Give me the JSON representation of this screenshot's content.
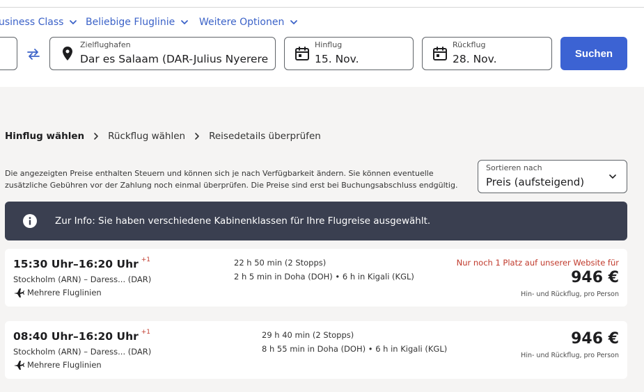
{
  "filters": {
    "cabin_label": "usiness Class",
    "airline_label": "Beliebige Fluglinie",
    "more_label": "Weitere Optionen"
  },
  "search": {
    "destination_label": "Zielflughafen",
    "destination_value": "Dar es Salaam (DAR-Julius Nyerere ...",
    "outbound_label": "Hinflug",
    "outbound_value": "15. Nov.",
    "return_label": "Rückflug",
    "return_value": "28. Nov.",
    "submit_label": "Suchen"
  },
  "breadcrumb": {
    "step1": "Hinflug wählen",
    "step2": "Rückflug wählen",
    "step3": "Reisedetails überprüfen"
  },
  "disclaimer": "Die angezeigten Preise enthalten Steuern und können sich je nach Verfügbarkeit ändern. Sie können eventuelle zusätzliche Gebühren vor der Zahlung noch einmal überprüfen. Die Preise sind erst bei Buchungsabschluss endgültig.",
  "sort": {
    "label": "Sortieren nach",
    "value": "Preis (aufsteigend)"
  },
  "info_banner": {
    "text": "Zur Info: Sie haben verschiedene Kabinenklassen für Ihre Flugreise ausgewählt."
  },
  "flights": [
    {
      "times": "15:30 Uhr–16:20 Uhr",
      "day_offset": "+1",
      "route": "Stockholm (ARN) – Daress... (DAR)",
      "airline": "Mehrere Fluglinien",
      "duration": "22 h 50 min (2 Stopps)",
      "layovers": "2 h 5 min in Doha (DOH) • 6 h in Kigali (KGL)",
      "warning": "Nur noch 1 Platz auf unserer Website für",
      "price": "946 €",
      "price_note": "Hin- und Rückflug, pro Person"
    },
    {
      "times": "08:40 Uhr–16:20 Uhr",
      "day_offset": "+1",
      "route": "Stockholm (ARN) – Daress... (DAR)",
      "airline": "Mehrere Fluglinien",
      "duration": "29 h 40 min (2 Stopps)",
      "layovers": "8 h 55 min in Doha (DOH) • 6 h in Kigali (KGL)",
      "warning": "",
      "price": "946 €",
      "price_note": "Hin- und Rückflug, pro Person"
    }
  ],
  "colors": {
    "accent": "#3c63d3",
    "banner": "#3a3f50",
    "warning": "#c0392b",
    "background": "#f5f4f3"
  },
  "icons": {
    "swap": "swap-arrows-icon",
    "location": "location-pin-icon",
    "calendar": "calendar-icon",
    "info": "info-icon",
    "plane": "plane-icon",
    "chevron": "chevron-down-icon"
  }
}
